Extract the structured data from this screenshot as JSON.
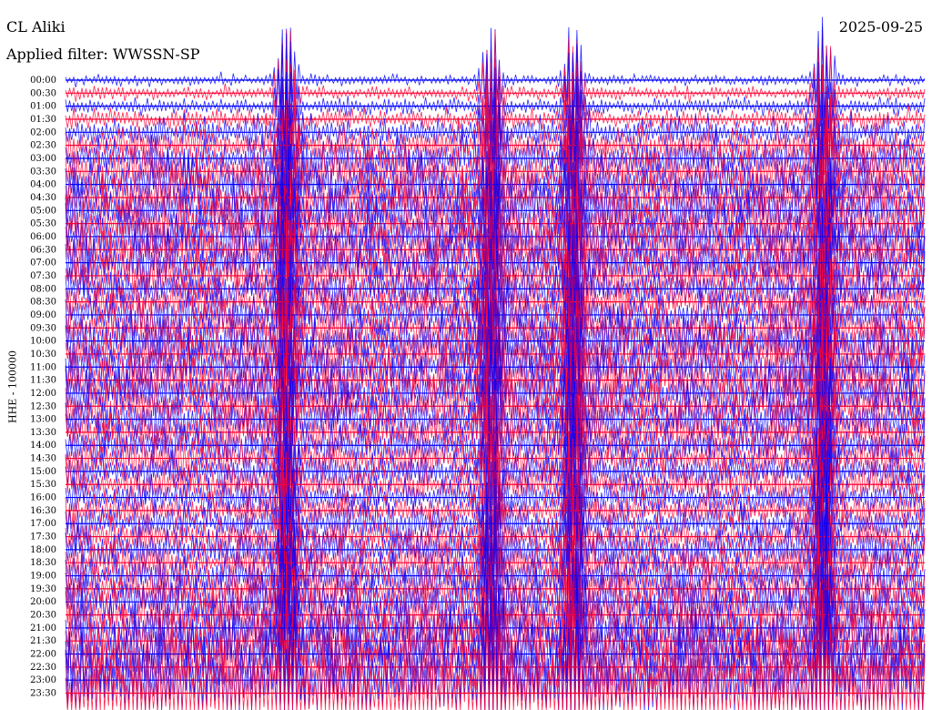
{
  "header": {
    "station": "CL Aliki",
    "date": "2025-09-25",
    "filter": "Applied filter: WWSSN-SP"
  },
  "chart_data": {
    "type": "line",
    "title": "CL Aliki",
    "subtitle": "Applied filter: WWSSN-SP",
    "date": "2025-09-25",
    "ylabel": "HHE - 100000",
    "y_tick_labels": [
      "00:00",
      "00:30",
      "01:00",
      "01:30",
      "02:00",
      "02:30",
      "03:00",
      "03:30",
      "04:00",
      "04:30",
      "05:00",
      "05:30",
      "06:00",
      "06:30",
      "07:00",
      "07:30",
      "08:00",
      "08:30",
      "09:00",
      "09:30",
      "10:00",
      "10:30",
      "11:00",
      "11:30",
      "12:00",
      "12:30",
      "13:00",
      "13:30",
      "14:00",
      "14:30",
      "15:00",
      "15:30",
      "16:00",
      "16:30",
      "17:00",
      "17:30",
      "18:00",
      "18:30",
      "19:00",
      "19:30",
      "20:00",
      "20:30",
      "21:00",
      "21:30",
      "22:00",
      "22:30",
      "23:00",
      "23:30"
    ],
    "trace_colors": [
      "#0000ff",
      "#ff0033"
    ],
    "trace_amplitude_by_line": [
      0.25,
      0.3,
      0.4,
      0.5,
      0.7,
      0.9,
      1.0,
      1.1,
      1.2,
      1.2,
      1.3,
      1.3,
      1.3,
      1.3,
      1.2,
      1.2,
      1.0,
      1.0,
      1.1,
      1.2,
      1.3,
      1.3,
      1.3,
      1.3,
      1.2,
      1.2,
      1.1,
      1.1,
      1.0,
      1.0,
      0.9,
      0.9,
      0.8,
      0.8,
      0.9,
      0.9,
      1.0,
      1.0,
      1.0,
      1.1,
      1.2,
      1.3,
      1.4,
      1.5,
      1.6,
      1.7,
      1.9,
      2.2
    ],
    "grid": false,
    "legend": "none"
  }
}
